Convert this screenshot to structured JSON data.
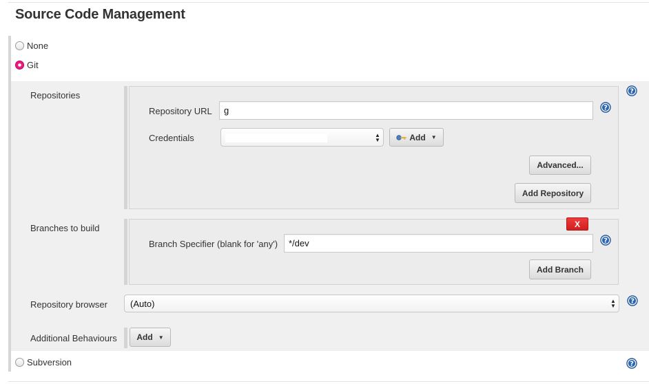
{
  "section": {
    "title": "Source Code Management"
  },
  "scm_options": {
    "none_label": "None",
    "git_label": "Git",
    "subversion_label": "Subversion",
    "selected": "Git"
  },
  "git": {
    "repositories": {
      "label": "Repositories",
      "repository_url_label": "Repository URL",
      "repository_url_value": "g",
      "credentials_label": "Credentials",
      "credentials_value": "",
      "add_credentials_label": "Add",
      "add_credentials_icon": "key-icon",
      "advanced_label": "Advanced...",
      "add_repository_label": "Add Repository"
    },
    "branches": {
      "label": "Branches to build",
      "delete_label": "X",
      "branch_specifier_label": "Branch Specifier (blank for 'any')",
      "branch_specifier_value": "*/dev",
      "add_branch_label": "Add Branch"
    },
    "repository_browser": {
      "label": "Repository browser",
      "value": "(Auto)"
    },
    "additional_behaviours": {
      "label": "Additional Behaviours",
      "add_label": "Add"
    }
  },
  "icons": {
    "help": "help-icon",
    "key": "key-icon",
    "caret": "chevron-down-icon"
  },
  "colors": {
    "radio_selected": "#ed1b7d",
    "help_icon": "#2a65b2",
    "delete_button": "#dd2a2a",
    "panel_background": "#f0f0f0"
  }
}
